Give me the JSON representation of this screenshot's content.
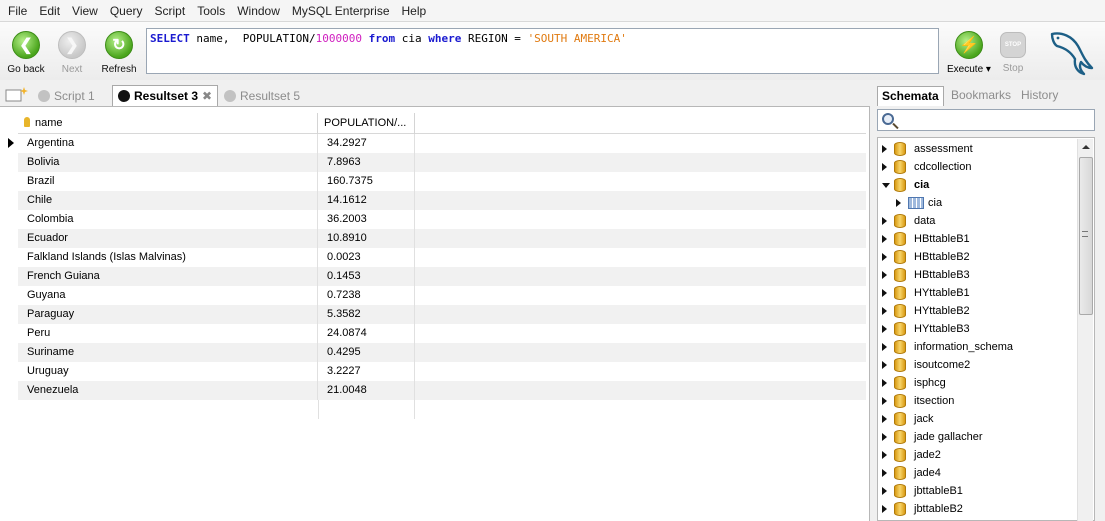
{
  "menu": [
    "File",
    "Edit",
    "View",
    "Query",
    "Script",
    "Tools",
    "Window",
    "MySQL Enterprise",
    "Help"
  ],
  "toolbar": {
    "back_label": "Go back",
    "next_label": "Next",
    "refresh_label": "Refresh",
    "execute_label": "Execute",
    "stop_label": "Stop",
    "stop_icon_text": "STOP"
  },
  "query": {
    "kw_select": "SELECT",
    "t1": " name,  POPULATION/",
    "num": "1000000",
    "sp1": " ",
    "kw_from": "from",
    "t2": " cia ",
    "kw_where": "where",
    "t3": " REGION = ",
    "str": "'SOUTH AMERICA'"
  },
  "tabs": {
    "script": "Script 1",
    "active": "Resultset 3",
    "other": "Resultset 5"
  },
  "grid": {
    "columns": [
      "name",
      "POPULATION/..."
    ],
    "rows": [
      [
        "Argentina",
        "34.2927"
      ],
      [
        "Bolivia",
        "7.8963"
      ],
      [
        "Brazil",
        "160.7375"
      ],
      [
        "Chile",
        "14.1612"
      ],
      [
        "Colombia",
        "36.2003"
      ],
      [
        "Ecuador",
        "10.8910"
      ],
      [
        "Falkland Islands (Islas Malvinas)",
        "0.0023"
      ],
      [
        "French Guiana",
        "0.1453"
      ],
      [
        "Guyana",
        "0.7238"
      ],
      [
        "Paraguay",
        "5.3582"
      ],
      [
        "Peru",
        "24.0874"
      ],
      [
        "Suriname",
        "0.4295"
      ],
      [
        "Uruguay",
        "3.2227"
      ],
      [
        "Venezuela",
        "21.0048"
      ]
    ]
  },
  "panel": {
    "tabs": [
      "Schemata",
      "Bookmarks",
      "History"
    ],
    "schemas": [
      {
        "label": "assessment",
        "expanded": false,
        "bold": false
      },
      {
        "label": "cdcollection",
        "expanded": false,
        "bold": false
      },
      {
        "label": "cia",
        "expanded": true,
        "bold": true
      },
      {
        "label": "cia",
        "child": true
      },
      {
        "label": "data",
        "expanded": false,
        "bold": false
      },
      {
        "label": "HBttableB1",
        "expanded": false,
        "bold": false
      },
      {
        "label": "HBttableB2",
        "expanded": false,
        "bold": false
      },
      {
        "label": "HBttableB3",
        "expanded": false,
        "bold": false
      },
      {
        "label": "HYttableB1",
        "expanded": false,
        "bold": false
      },
      {
        "label": "HYttableB2",
        "expanded": false,
        "bold": false
      },
      {
        "label": "HYttableB3",
        "expanded": false,
        "bold": false
      },
      {
        "label": "information_schema",
        "expanded": false,
        "bold": false
      },
      {
        "label": "isoutcome2",
        "expanded": false,
        "bold": false
      },
      {
        "label": "isphcg",
        "expanded": false,
        "bold": false
      },
      {
        "label": "itsection",
        "expanded": false,
        "bold": false
      },
      {
        "label": "jack",
        "expanded": false,
        "bold": false
      },
      {
        "label": "jade gallacher",
        "expanded": false,
        "bold": false
      },
      {
        "label": "jade2",
        "expanded": false,
        "bold": false
      },
      {
        "label": "jade4",
        "expanded": false,
        "bold": false
      },
      {
        "label": "jbttableB1",
        "expanded": false,
        "bold": false
      },
      {
        "label": "jbttableB2",
        "expanded": false,
        "bold": false
      }
    ]
  }
}
